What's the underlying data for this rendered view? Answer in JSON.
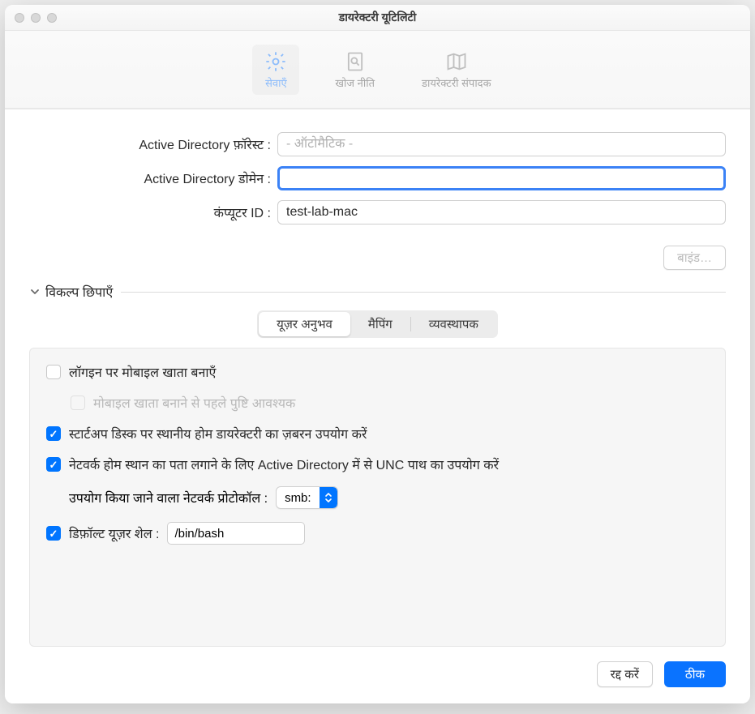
{
  "window": {
    "title": "डायरेक्टरी यूटिलिटी"
  },
  "toolbar": {
    "services": "सेवाएँ",
    "search_policy": "खोज नीति",
    "directory_editor": "डायरेक्टरी संपादक"
  },
  "form": {
    "forest_label": "Active Directory फ़ॉरेस्ट :",
    "forest_placeholder": "- ऑटोमैटिक -",
    "domain_label": "Active Directory डोमेन :",
    "domain_value": "",
    "computer_id_label": "कंप्यूटर ID :",
    "computer_id_value": "test-lab-mac",
    "bind_button": "बाइंड…"
  },
  "disclosure": {
    "label": "विकल्प छिपाएँ"
  },
  "tabs": {
    "user_experience": "यूज़र अनुभव",
    "mapping": "मैपिंग",
    "admin": "व्यवस्थापक"
  },
  "options": {
    "create_mobile": "लॉगइन पर मोबाइल खाता बनाएँ",
    "confirm_mobile": "मोबाइल खाता बनाने से पहले पुष्टि आवश्यक",
    "force_local_home": "स्टार्टअप डिस्क पर स्थानीय होम डायरेक्टरी का ज़बरन उपयोग करें",
    "use_unc": "नेटवर्क होम स्थान का पता लगाने के लिए Active Directory में से UNC पाथ का उपयोग करें",
    "protocol_label": "उपयोग किया जाने वाला नेटवर्क प्रोटोकॉल :",
    "protocol_value": "smb:",
    "default_shell_label": "डिफ़ॉल्ट यूज़र शेल :",
    "default_shell_value": "/bin/bash"
  },
  "footer": {
    "cancel": "रद्द करें",
    "ok": "ठीक"
  }
}
